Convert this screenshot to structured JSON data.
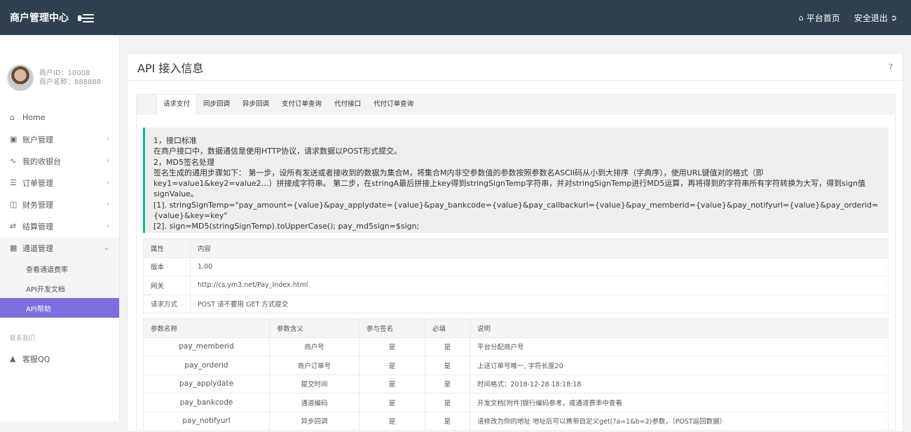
{
  "header": {
    "brand": "商户管理中心",
    "home_label": "平台首页",
    "logout_label": "安全退出"
  },
  "profile": {
    "merchant_id": "商户ID：10008",
    "merchant_name": "商户名称：888888"
  },
  "sidebar": {
    "items": [
      {
        "label": "Home",
        "icon": "home-icon"
      },
      {
        "label": "账户管理",
        "icon": "book-icon"
      },
      {
        "label": "我的收银台",
        "icon": "chart-icon"
      },
      {
        "label": "订单管理",
        "icon": "list-icon"
      },
      {
        "label": "财务管理",
        "icon": "money-icon"
      },
      {
        "label": "结算管理",
        "icon": "transfer-icon"
      },
      {
        "label": "通道管理",
        "icon": "channel-icon"
      }
    ],
    "sub_items": [
      "查看通道费率",
      "API开发文档",
      "API帮助"
    ],
    "section_label": "联系我们",
    "qq_label": "客服QQ"
  },
  "main": {
    "title": "API 接入信息",
    "help": "?"
  },
  "tabs": [
    "请求支付",
    "同步回调",
    "异步回调",
    "支付订单查询",
    "代付接口",
    "代付订单查询"
  ],
  "notice": {
    "line1": "1，接口标准",
    "line2": "在商户接口中，数据通信是使用HTTP协议，请求数据以POST形式提交。",
    "line3": "2，MD5签名处理",
    "line4": "签名生成的通用步骤如下： 第一步，设所有发送或者接收到的数据为集合M，将集合M内非空参数值的参数按照参数名ASCII码从小到大排序（字典序），使用URL键值对的格式（即key1=value1&key2=value2…）拼接成字符串。 第二步，在stringA最后拼接上key得到stringSignTemp字符串，并对stringSignTemp进行MD5运算，再将得到的字符串所有字符转换为大写，得到sign值signValue。",
    "line5": "[1]. stringSignTemp=\"pay_amount={value}&pay_applydate={value}&pay_bankcode={value}&pay_callbackurl={value}&pay_memberid={value}&pay_notifyurl={value}&pay_orderid={value}&key=key\"",
    "line6": "[2]. sign=MD5(stringSignTemp).toUpperCase(); pay_md5sign=$sign;"
  },
  "info_table": {
    "headers": [
      "属性",
      "内容"
    ],
    "rows": [
      [
        "版本",
        "1.00"
      ],
      [
        "网关",
        "http://cs.ym3.net/Pay_Index.html"
      ],
      [
        "请求方式",
        "POST 请不要用 GET 方式提交"
      ]
    ]
  },
  "param_table": {
    "headers": [
      "参数名称",
      "参数含义",
      "参与签名",
      "必填",
      "说明"
    ],
    "rows": [
      [
        "pay_memberid",
        "商户号",
        "是",
        "是",
        "平台分配商户号"
      ],
      [
        "pay_orderid",
        "商户订单号",
        "是",
        "是",
        "上送订单号唯一, 字符长度20"
      ],
      [
        "pay_applydate",
        "提交时间",
        "是",
        "是",
        "时间格式：2018-12-28 18:18:18"
      ],
      [
        "pay_bankcode",
        "通道编码",
        "是",
        "是",
        "开发文档[附件]银行编码参考，或通道费率中查看"
      ],
      [
        "pay_notifyurl",
        "异步回调",
        "是",
        "是",
        "请修改为你的地址 地址后可以携带自定义get(?a=1&b=2)参数，（POST返回数据）"
      ]
    ]
  }
}
